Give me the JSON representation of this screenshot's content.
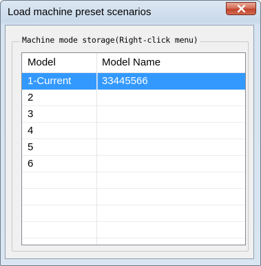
{
  "window": {
    "title": "Load machine preset scenarios"
  },
  "icons": {
    "close": "close-icon"
  },
  "group": {
    "caption": "Machine mode storage(Right-click menu)"
  },
  "table": {
    "columns": [
      "Model",
      "Model Name"
    ],
    "rows": [
      {
        "model": "1-Current",
        "name": "33445566",
        "selected": true
      },
      {
        "model": "2",
        "name": "",
        "selected": false
      },
      {
        "model": "3",
        "name": "",
        "selected": false
      },
      {
        "model": "4",
        "name": "",
        "selected": false
      },
      {
        "model": "5",
        "name": "",
        "selected": false
      },
      {
        "model": "6",
        "name": "",
        "selected": false
      }
    ]
  },
  "colors": {
    "selection": "#3399ff",
    "close_button": "#c2432c"
  }
}
